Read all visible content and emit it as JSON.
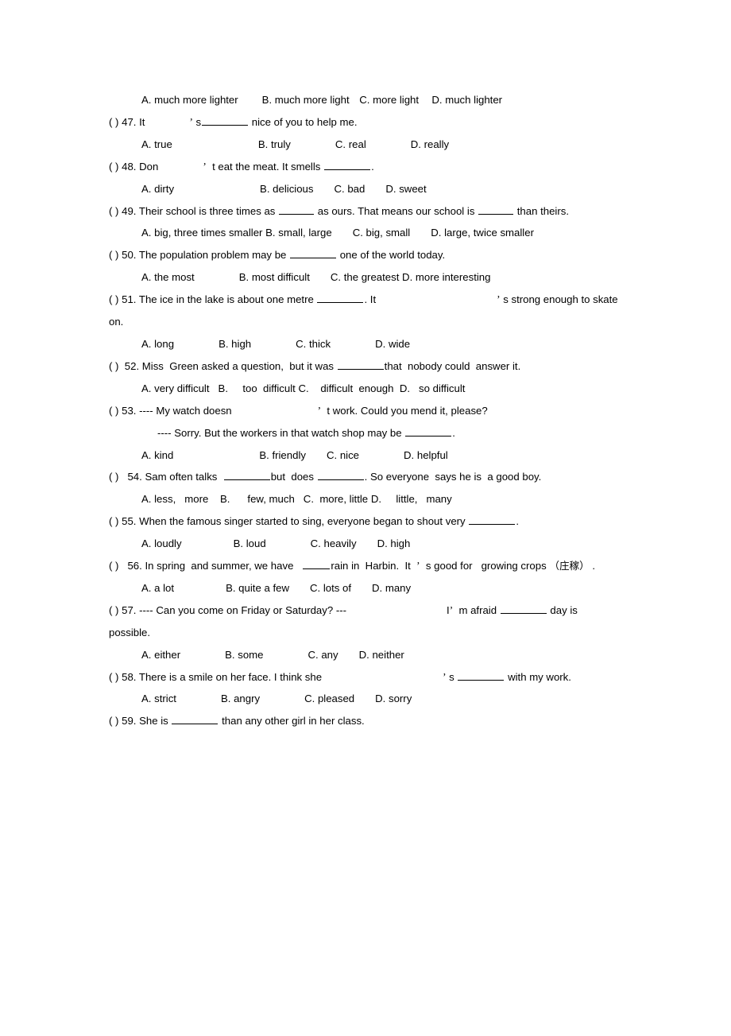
{
  "document": {
    "type": "english-grammar-worksheet",
    "page_background": "#ffffff",
    "text_color": "#000000",
    "blocks": [
      {
        "id": "q46-options",
        "kind": "options",
        "indent": true,
        "justify": false,
        "text": "A. much more lighter    B. much more light   C. more light    D. much lighter"
      },
      {
        "id": "q47-stem",
        "kind": "question",
        "indent": false,
        "justify": false,
        "number": "47",
        "text": "( ) 47. It        ’ s ________ nice of you to help me."
      },
      {
        "id": "q47-options",
        "kind": "options",
        "indent": true,
        "justify": false,
        "text": "A. true              B. truly          C. real          D. really"
      },
      {
        "id": "q48-stem",
        "kind": "question",
        "indent": false,
        "justify": false,
        "number": "48",
        "text": "( ) 48. Don       ’  t eat the meat. It smells ________."
      },
      {
        "id": "q48-options",
        "kind": "options",
        "indent": true,
        "justify": false,
        "text": "A. dirty              B. delicious      C. bad        D. sweet"
      },
      {
        "id": "q49-stem",
        "kind": "question",
        "indent": false,
        "justify": false,
        "number": "49",
        "text": "( ) 49. Their school is three times as _____ as ours. That means our school is ______ than theirs."
      },
      {
        "id": "q49-options",
        "kind": "options",
        "indent": true,
        "justify": false,
        "text": "A. big, three times smaller B. small, large    C. big, small    D. large, twice smaller"
      },
      {
        "id": "q50-stem",
        "kind": "question",
        "indent": false,
        "justify": false,
        "number": "50",
        "text": "( ) 50. The population problem may be ________ one of the world today."
      },
      {
        "id": "q50-options",
        "kind": "options",
        "indent": true,
        "justify": false,
        "text": "A. the most        B. most difficult      C. the greatest  D. more interesting"
      },
      {
        "id": "q51-stem",
        "kind": "question",
        "indent": false,
        "justify": false,
        "number": "51",
        "text": "( ) 51. The ice in the lake is about one metre ________. It                    ’ s strong enough to skate on."
      },
      {
        "id": "q51-options",
        "kind": "options",
        "indent": true,
        "justify": false,
        "text": "A. long            B. high         C. thick        D. wide"
      },
      {
        "id": "q52-stem",
        "kind": "question",
        "indent": false,
        "justify": true,
        "number": "52",
        "text": "( )  52.  Miss   Green asked a question,   but  it  was ________ that   nobody could   answer it."
      },
      {
        "id": "q52-options",
        "kind": "options",
        "indent": true,
        "justify": true,
        "text": "A. very   difficult    B.          too    difficult  C.        difficult      enough    D.      so difficult"
      },
      {
        "id": "q53-stem",
        "kind": "question",
        "indent": false,
        "justify": false,
        "number": "53",
        "text": "( ) 53. ---- My watch doesn          ’  t work. Could you mend it, please?"
      },
      {
        "id": "q53-reply",
        "kind": "dialogue",
        "indent": true,
        "justify": false,
        "text": "---- Sorry. But the workers in that watch shop may be ________."
      },
      {
        "id": "q53-options",
        "kind": "options",
        "indent": true,
        "justify": false,
        "text": "A. kind             B. friendly      C. nice        D. helpful"
      },
      {
        "id": "q54-stem",
        "kind": "question",
        "indent": false,
        "justify": true,
        "number": "54",
        "text": "( )   54.  Sam often  talks   ________ but  does  ________. So everyone   says  he is   a good boy."
      },
      {
        "id": "q54-options",
        "kind": "options",
        "indent": true,
        "justify": true,
        "text": "A. less,    more      B.        few,  much     C.    more, little   D.       little,     many"
      },
      {
        "id": "q55-stem",
        "kind": "question",
        "indent": false,
        "justify": false,
        "number": "55",
        "text": "( ) 55. When the famous singer started to sing, everyone began to shout very ________."
      },
      {
        "id": "q55-options",
        "kind": "options",
        "indent": true,
        "justify": false,
        "text": "A. loudly            B. loud         C. heavily     D. high"
      },
      {
        "id": "q56-stem",
        "kind": "question",
        "indent": false,
        "justify": true,
        "number": "56",
        "text": "( )   56.  In  spring   and summer, we have    ____ rain  in  Harbin.  It   ’  s good for   growing crops （庄稼）."
      },
      {
        "id": "q56-options",
        "kind": "options",
        "indent": true,
        "justify": false,
        "text": "A. a lot              B. quite a few     C. lots of    D. many"
      },
      {
        "id": "q57-stem",
        "kind": "question",
        "indent": false,
        "justify": false,
        "number": "57",
        "text": "( ) 57. ---- Can you come on Friday or Saturday? ---              I ’  m afraid ________ day is possible."
      },
      {
        "id": "q57-options",
        "kind": "options",
        "indent": true,
        "justify": false,
        "text": "A. either          B. some         C. any        D. neither"
      },
      {
        "id": "q58-stem",
        "kind": "question",
        "indent": false,
        "justify": false,
        "number": "58",
        "text": "( ) 58. There is a smile on her face. I think she                      ’ s ________ with my work."
      },
      {
        "id": "q58-options",
        "kind": "options",
        "indent": true,
        "justify": false,
        "text": "A. strict            B. angry         C. pleased    D. sorry"
      },
      {
        "id": "q59-stem",
        "kind": "question",
        "indent": false,
        "justify": false,
        "number": "59",
        "text": "( ) 59. She is ________ than any other girl in her class."
      }
    ],
    "lines": {
      "q46_options": {
        "a": "A. much more lighter",
        "b": "B. much more light",
        "c": "C. more light",
        "d": "D. much lighter"
      },
      "q47": {
        "marker": "( ) 47.",
        "stem_pre": "It",
        "apostrophe": "’",
        "stem_post": "s",
        "stem_tail": "nice of you to help me.",
        "a": "A. true",
        "b": "B. truly",
        "c": "C. real",
        "d": "D. really"
      },
      "q48": {
        "marker": "( ) 48.",
        "stem_pre": "Don",
        "apostrophe": "’",
        "stem_post": "t eat the meat. It smells",
        "stem_tail": ".",
        "a": "A. dirty",
        "b": "B. delicious",
        "c": "C. bad",
        "d": "D. sweet"
      },
      "q49": {
        "marker": "( ) 49.",
        "stem_pre": "Their school is three times as",
        "stem_mid": "as ours. That means our school is",
        "stem_post": "than theirs.",
        "a": "A. big, three times smaller",
        "b": "B. small, large",
        "c": "C. big, small",
        "d": "D. large, twice smaller"
      },
      "q50": {
        "marker": "( ) 50.",
        "stem_pre": "The population problem may be",
        "stem_post": "one of the world today.",
        "a": "A. the most",
        "b": "B. most difficult",
        "c": "C. the greatest",
        "d": "D. more interesting"
      },
      "q51": {
        "marker": "( ) 51.",
        "stem_pre": "The ice in the lake is about one metre",
        "stem_mid": ". It",
        "apostrophe": "’",
        "stem_post": "s strong enough to skate on.",
        "a": "A. long",
        "b": "B. high",
        "c": "C. thick",
        "d": "D. wide"
      },
      "q52": {
        "marker": "( )",
        "number": "52.",
        "stem_pre": "Miss",
        "stem_a": "Green asked a question,",
        "stem_b": "but",
        "stem_c": "it",
        "stem_d": "was",
        "stem_e": "that",
        "stem_f": "nobody could",
        "stem_g": "answer",
        "stem_h": "it.",
        "a1": "A. very",
        "a2": "difficult",
        "b1": "B.",
        "b2": "too",
        "b3": "difficult",
        "c1": "C.",
        "c2": "difficult",
        "c3": "enough",
        "d1": "D.",
        "d2": "so",
        "d3": "difficult"
      },
      "q53": {
        "marker": "( ) 53.",
        "stem_pre": "---- My watch doesn",
        "apostrophe": "’",
        "stem_post": "t work. Could you mend it, please?",
        "reply_pre": "---- Sorry. But the workers in that watch shop may be",
        "reply_post": ".",
        "a": "A. kind",
        "b": "B. friendly",
        "c": "C. nice",
        "d": "D. helpful"
      },
      "q54": {
        "marker": "( )",
        "number": "54.",
        "stem_a": "Sam often",
        "stem_b": "talks",
        "stem_c": "but",
        "stem_d": "does",
        "stem_e": ". So everyone",
        "stem_f": "says",
        "stem_g": "he is",
        "stem_h": "a good",
        "stem_i": "boy.",
        "a1": "A. less,",
        "a2": "more",
        "b1": "B.",
        "b2": "few,",
        "b3": "much",
        "c1": "C.",
        "c2": "more, little",
        "d1": "D.",
        "d2": "little,",
        "d3": "many"
      },
      "q55": {
        "marker": "( ) 55.",
        "stem_pre": "When the famous singer started to sing, everyone began to shout very",
        "stem_post": ".",
        "a": "A. loudly",
        "b": "B. loud",
        "c": "C. heavily",
        "d": "D. high"
      },
      "q56": {
        "marker": "( )",
        "number": "56.",
        "stem_a": "In",
        "stem_b": "spring",
        "stem_c": "and summer, we have",
        "stem_d": "rain",
        "stem_e": "in",
        "stem_f": "Harbin.",
        "stem_g": "It",
        "apostrophe": "’",
        "stem_h": "s good for",
        "stem_i": "growing",
        "stem_j": "crops",
        "stem_cjk": "（庄稼）",
        "stem_k": ".",
        "a": "A. a lot",
        "b": "B. quite a few",
        "c": "C. lots of",
        "d": "D. many"
      },
      "q57": {
        "marker": "( ) 57.",
        "stem_pre": "---- Can you come on Friday or Saturday? ---",
        "stem_i": "I",
        "apostrophe": "’",
        "stem_post": "m afraid",
        "stem_tail": "day is possible.",
        "a": "A. either",
        "b": "B. some",
        "c": "C. any",
        "d": "D. neither"
      },
      "q58": {
        "marker": "( ) 58.",
        "stem_pre": "There is a smile on her face. I think she",
        "apostrophe": "’",
        "stem_post": "s",
        "stem_tail": "with my work.",
        "a": "A. strict",
        "b": "B. angry",
        "c": "C. pleased",
        "d": "D. sorry"
      },
      "q59": {
        "marker": "( ) 59.",
        "stem_pre": "She is",
        "stem_post": "than any other girl in her class."
      }
    }
  }
}
